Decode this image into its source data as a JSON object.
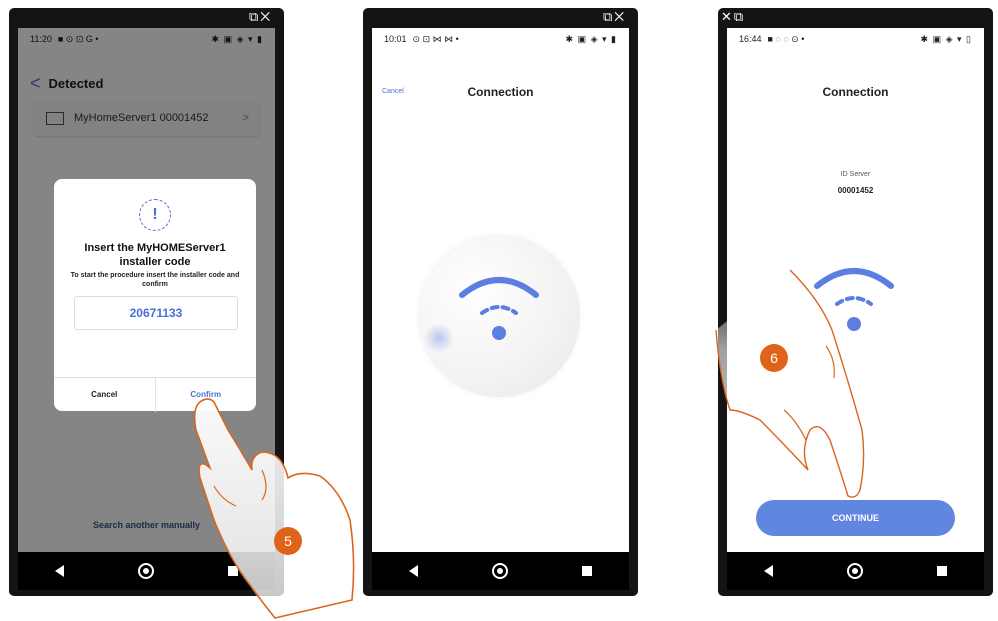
{
  "screen1": {
    "time": "11:20",
    "header_back": "<",
    "header_title": "Detected",
    "list_item_label": "MyHomeServer1 00001452",
    "list_item_chevron": ">",
    "dialog": {
      "icon": "!",
      "title": "Insert the MyHOMEServer1 installer code",
      "description": "To start the procedure insert the installer code and confirm",
      "code_value": "20671133",
      "cancel_label": "Cancel",
      "confirm_label": "Confirm"
    },
    "search_manually": "Search another manually",
    "step_badge": "5"
  },
  "screen2": {
    "time": "10:01",
    "cancel_label": "Cancel",
    "title": "Connection"
  },
  "screen3": {
    "time": "16:44",
    "title": "Connection",
    "id_label": "ID Server",
    "id_value": "00001452",
    "continue_label": "CONTINUE",
    "step_badge": "6"
  },
  "colors": {
    "accent": "#4a6fd8",
    "button": "#6186e0",
    "step_badge": "#e0631a",
    "hand_outline": "#d9661e"
  }
}
